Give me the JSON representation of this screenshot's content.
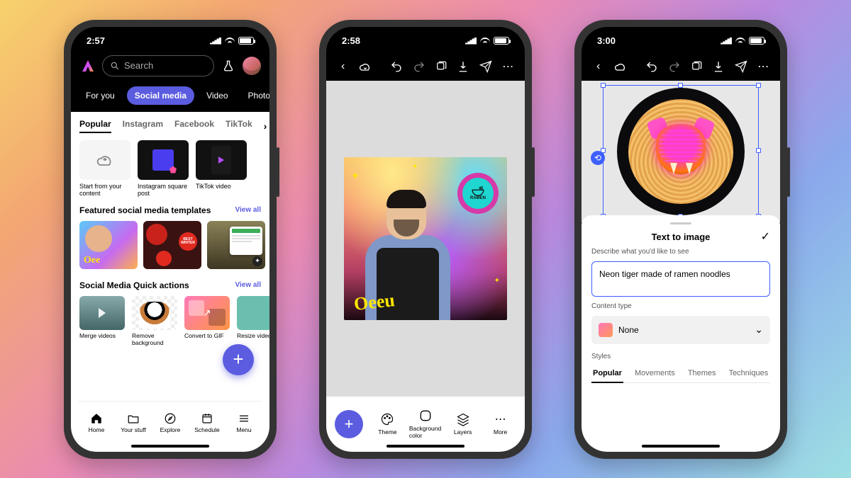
{
  "phone1": {
    "time": "2:57",
    "search_placeholder": "Search",
    "category_tabs": [
      "For you",
      "Social media",
      "Video",
      "Photo"
    ],
    "category_active": "Social media",
    "sub_tabs": [
      "Popular",
      "Instagram",
      "Facebook",
      "TikTok"
    ],
    "sub_active": "Popular",
    "create_cards": [
      {
        "label": "Start from your content"
      },
      {
        "label": "Instagram square post"
      },
      {
        "label": "TikTok video"
      }
    ],
    "featured_title": "Featured social media templates",
    "view_all": "View all",
    "quick_title": "Social Media Quick actions",
    "quick_actions": [
      {
        "label": "Merge videos"
      },
      {
        "label": "Remove background"
      },
      {
        "label": "Convert to GIF"
      },
      {
        "label": "Resize video"
      }
    ],
    "nav": [
      {
        "label": "Home"
      },
      {
        "label": "Your stuff"
      },
      {
        "label": "Explore"
      },
      {
        "label": "Schedule"
      },
      {
        "label": "Menu"
      }
    ]
  },
  "phone2": {
    "time": "2:58",
    "badge_text": "RAMEN",
    "bottom_tools": [
      {
        "label": "Theme"
      },
      {
        "label": "Background color"
      },
      {
        "label": "Layers"
      },
      {
        "label": "More"
      }
    ]
  },
  "phone3": {
    "time": "3:00",
    "sheet_title": "Text to image",
    "prompt_label": "Describe what you'd like to see",
    "prompt_value": "Neon tiger made of ramen noodles",
    "content_type_label": "Content type",
    "content_type_value": "None",
    "styles_label": "Styles",
    "style_tabs": [
      "Popular",
      "Movements",
      "Themes",
      "Techniques"
    ],
    "style_active": "Popular"
  }
}
